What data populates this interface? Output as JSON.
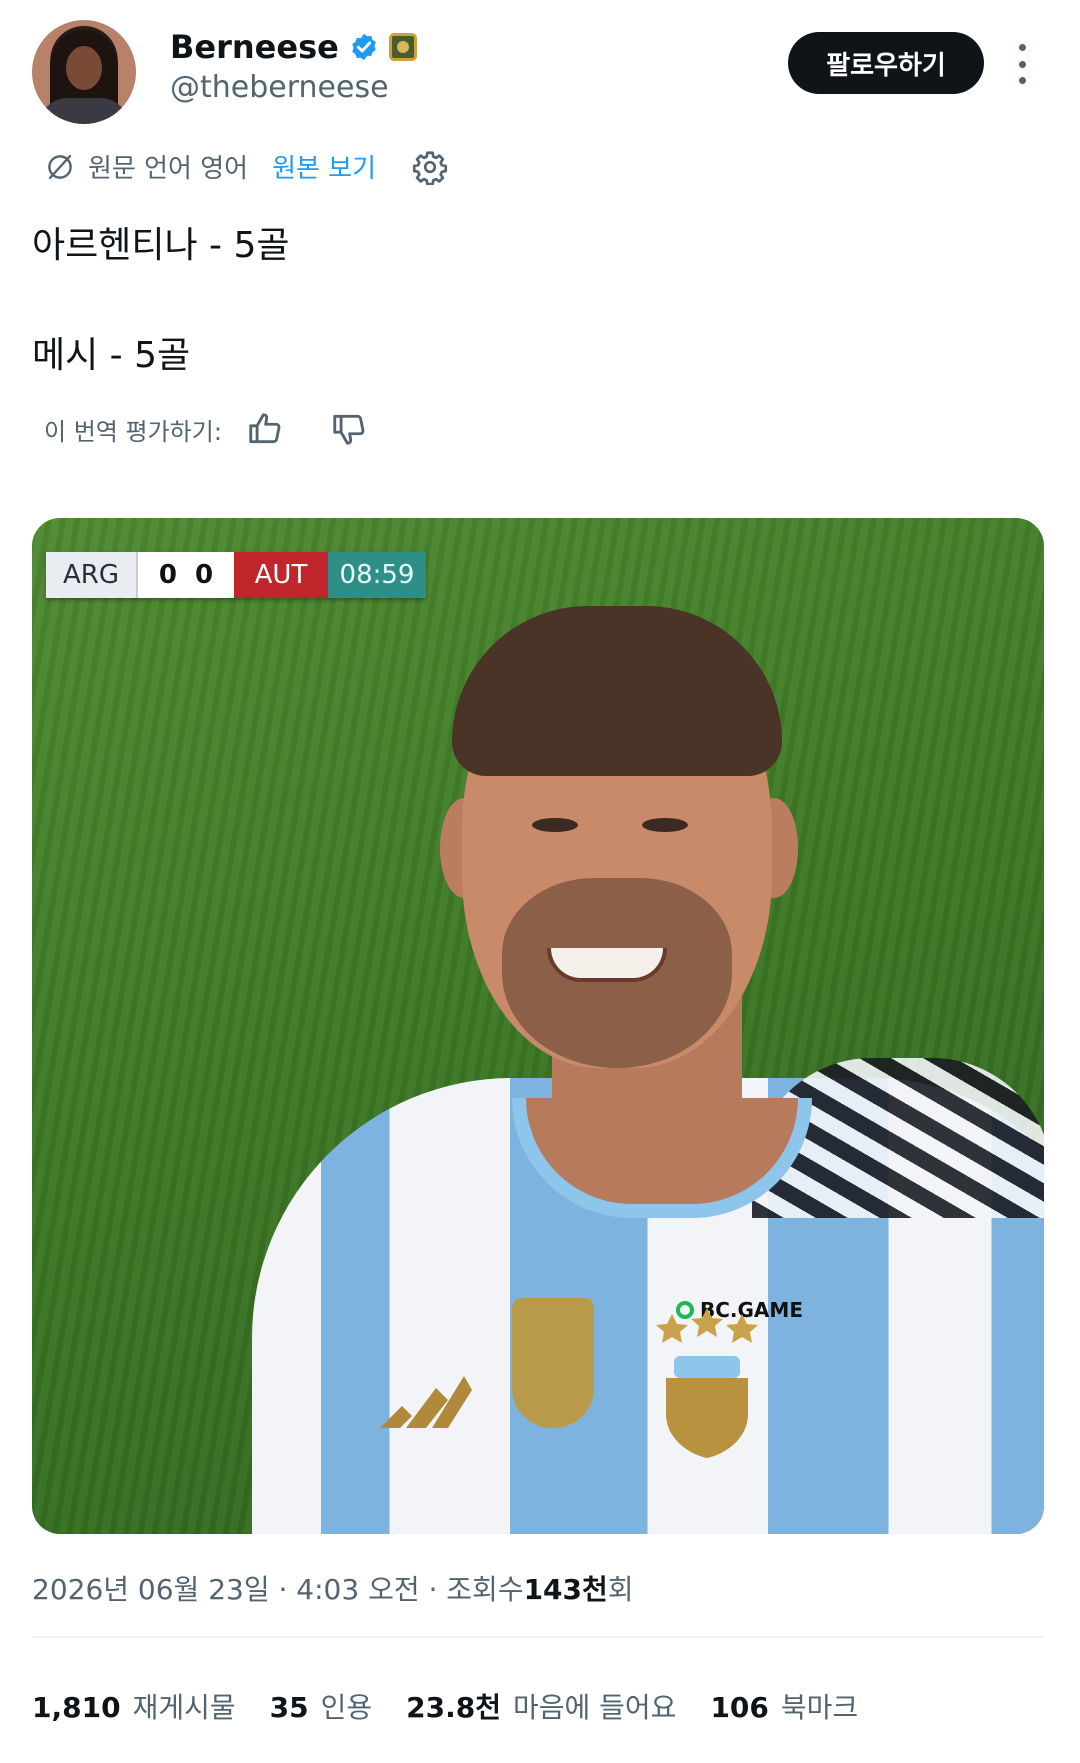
{
  "author": {
    "display_name": "Berneese",
    "handle": "@theberneese",
    "verified": true
  },
  "follow_label": "팔로우하기",
  "translation": {
    "original_language": "원문 언어 영어",
    "show_original": "원본 보기",
    "rate_prompt": "이 번역 평가하기:"
  },
  "tweet": {
    "line1": "아르헨티나 - 5골",
    "line2": "메시 - 5골"
  },
  "media": {
    "scoreboard": {
      "home": "ARG",
      "home_score": "0",
      "away_score": "0",
      "away": "AUT",
      "clock": "08:59"
    },
    "sponsor": "BC.GAME"
  },
  "meta": {
    "timestamp": "2026년 06월 23일 · 4:03 오전 · 조회수 ",
    "views_value": "143천",
    "views_suffix": "회"
  },
  "stats": [
    {
      "value": "1,810",
      "label": "재게시물"
    },
    {
      "value": "35",
      "label": "인용"
    },
    {
      "value": "23.8천",
      "label": "마음에 들어요"
    },
    {
      "value": "106",
      "label": "북마크"
    }
  ],
  "colors": {
    "accent": "#1d9bf0",
    "text_primary": "#0f1419",
    "text_secondary": "#536471",
    "follow_button_bg": "#0f1419"
  },
  "icons": {
    "verified": "verified-check-icon",
    "badge": "affiliate-badge-icon",
    "more": "more-vertical-icon",
    "translate": "translate-icon",
    "settings": "gear-icon",
    "thumbs_up": "thumbs-up-icon",
    "thumbs_down": "thumbs-down-icon"
  }
}
